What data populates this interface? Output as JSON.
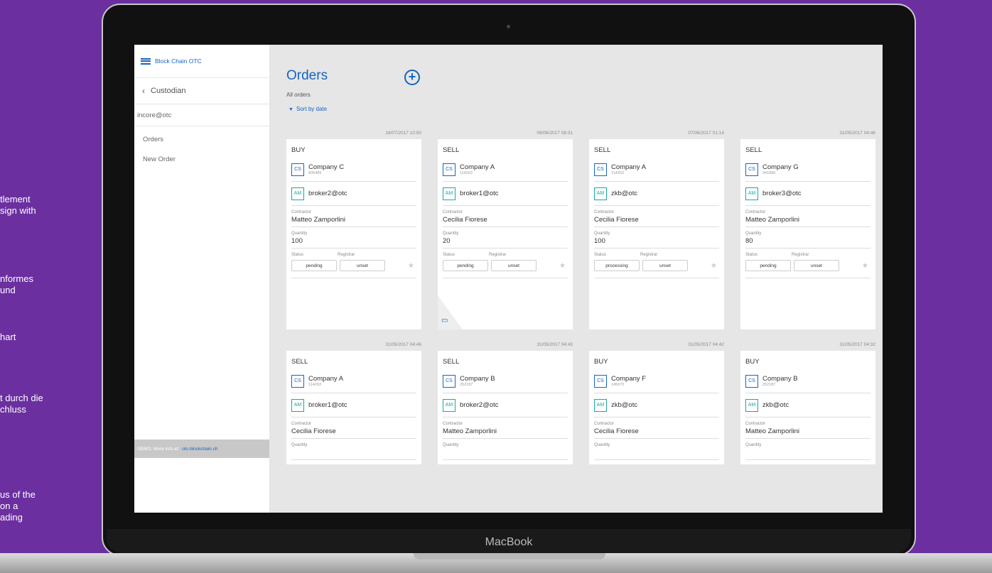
{
  "background_text": [
    "tlement",
    "sign with",
    "nformes",
    "und",
    "hart",
    "t durch die",
    "chluss",
    "us of the",
    "on a",
    "ading"
  ],
  "device_brand": "MacBook",
  "sidebar": {
    "app_title": "Block Chain OTC",
    "back_label": "Custodian",
    "user": "incore@otc",
    "items": [
      {
        "label": "Orders"
      },
      {
        "label": "New Order"
      }
    ],
    "footer_text": "DEMO. More info at:",
    "footer_link": "otc-blockchain.ch"
  },
  "main": {
    "title": "Orders",
    "subtitle": "All orders",
    "sort_label": "Sort by date",
    "labels": {
      "contractor": "Contractor",
      "quantity": "Quantity",
      "status": "Status",
      "registrar": "Registrar"
    },
    "orders": [
      {
        "date": "18/07/2017 10:50",
        "side": "BUY",
        "company_badge": "CS",
        "company": "Company C",
        "company_id": "835489",
        "broker_badge": "AM",
        "broker": "broker2@otc",
        "contractor": "Matteo Zamporlini",
        "quantity": "100",
        "status": "pending",
        "registrar": "unset"
      },
      {
        "date": "09/06/2017 08:31",
        "side": "SELL",
        "company_badge": "CS",
        "company": "Company A",
        "company_id": "114263",
        "broker_badge": "AM",
        "broker": "broker1@otc",
        "contractor": "Cecilia Fiorese",
        "quantity": "20",
        "status": "pending",
        "registrar": "unset"
      },
      {
        "date": "07/06/2017 01:14",
        "side": "SELL",
        "company_badge": "CS",
        "company": "Company A",
        "company_id": "114263",
        "broker_badge": "AM",
        "broker": "zkb@otc",
        "contractor": "Cecilia Fiorese",
        "quantity": "100",
        "status": "processing",
        "registrar": "unset"
      },
      {
        "date": "31/05/2017 04:46",
        "side": "SELL",
        "company_badge": "CS",
        "company": "Company G",
        "company_id": "341890",
        "broker_badge": "AM",
        "broker": "broker3@otc",
        "contractor": "Matteo Zamporlini",
        "quantity": "80",
        "status": "pending",
        "registrar": "unset"
      },
      {
        "date": "31/05/2017 04:46",
        "side": "SELL",
        "company_badge": "CS",
        "company": "Company A",
        "company_id": "114263",
        "broker_badge": "AM",
        "broker": "broker1@otc",
        "contractor": "Cecilia Fiorese"
      },
      {
        "date": "31/05/2017 04:43",
        "side": "SELL",
        "company_badge": "CS",
        "company": "Company B",
        "company_id": "252187",
        "broker_badge": "AM",
        "broker": "broker2@otc",
        "contractor": "Matteo Zamporlini"
      },
      {
        "date": "31/05/2017 04:42",
        "side": "BUY",
        "company_badge": "CS",
        "company": "Company F",
        "company_id": "145672",
        "broker_badge": "AM",
        "broker": "zkb@otc",
        "contractor": "Cecilia Fiorese"
      },
      {
        "date": "31/05/2017 04:32",
        "side": "BUY",
        "company_badge": "CS",
        "company": "Company B",
        "company_id": "252187",
        "broker_badge": "AM",
        "broker": "zkb@otc",
        "contractor": "Matteo Zamporlini"
      }
    ]
  }
}
